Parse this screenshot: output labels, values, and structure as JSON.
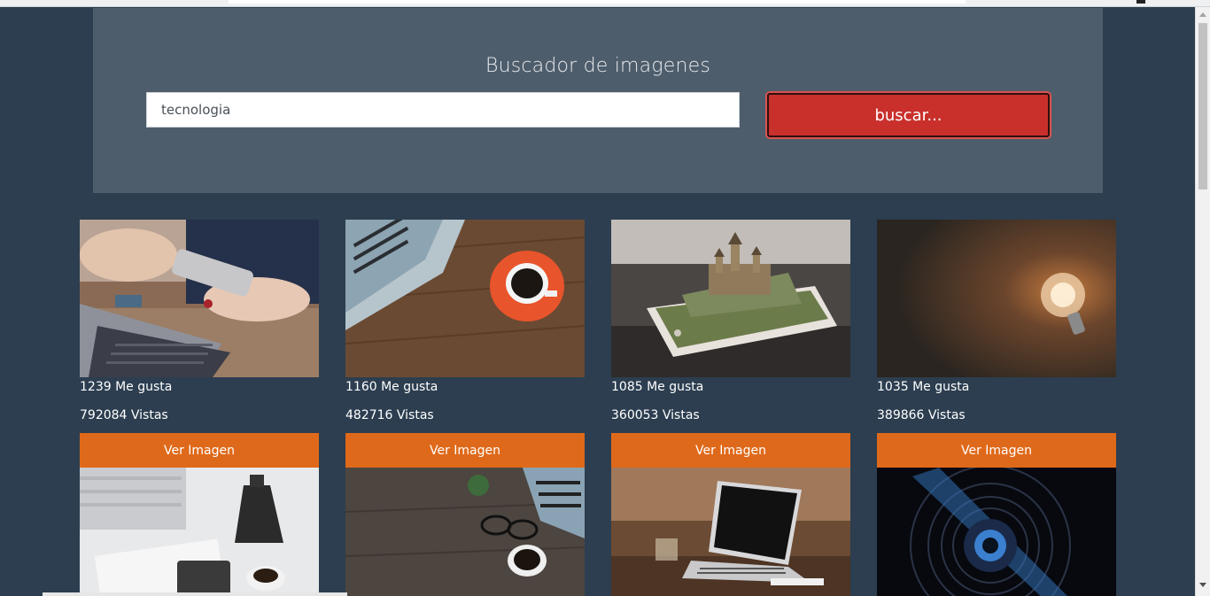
{
  "search": {
    "title": "Buscador de imagenes",
    "value": "tecnologia",
    "button_label": "buscar..."
  },
  "colors": {
    "background": "#2c3e50",
    "jumbotron": "#4e5d6c",
    "search_button": "#c9302c",
    "card_button": "#df691a"
  },
  "results": [
    {
      "likes": "1239 Me gusta",
      "views": "792084 Vistas",
      "button": "Ver Imagen",
      "image": "laptop-and-smartphone-photo"
    },
    {
      "likes": "1160 Me gusta",
      "views": "482716 Vistas",
      "button": "Ver Imagen",
      "image": "laptop-and-coffee-photo"
    },
    {
      "likes": "1085 Me gusta",
      "views": "360053 Vistas",
      "button": "Ver Imagen",
      "image": "castle-on-smartphone-photo"
    },
    {
      "likes": "1035 Me gusta",
      "views": "389866 Vistas",
      "button": "Ver Imagen",
      "image": "light-bulb-photo"
    }
  ],
  "next_row_images": [
    "desk-with-coffee-pot-photo",
    "desk-with-glasses-and-coffee-photo",
    "laptop-on-table-photo",
    "camera-lens-photo"
  ]
}
